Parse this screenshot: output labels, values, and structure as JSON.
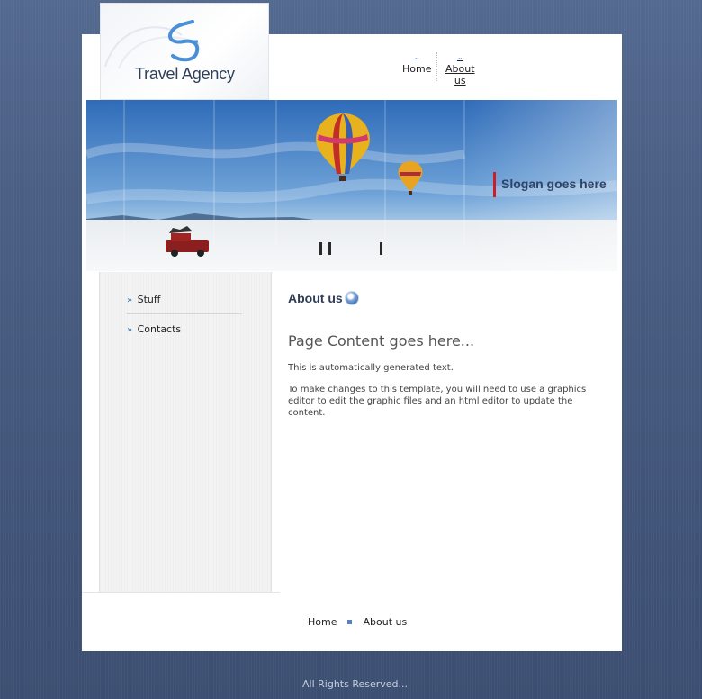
{
  "header": {
    "logo_text": "Travel Agency",
    "nav": [
      {
        "label": "Home"
      },
      {
        "label": "About us"
      }
    ]
  },
  "banner": {
    "slogan": "Slogan goes here"
  },
  "sidebar": {
    "items": [
      {
        "label": "Stuff"
      },
      {
        "label": "Contacts"
      }
    ]
  },
  "content": {
    "title": "About us",
    "heading": "Page Content goes here...",
    "p1": "This is automatically generated text.",
    "p2": "To make changes to this template, you will need to use a graphics editor to edit the graphic files and an html editor to update the content."
  },
  "footer": {
    "nav": [
      {
        "label": "Home"
      },
      {
        "label": "About us"
      }
    ],
    "copyright": "All Rights Reserved..."
  },
  "colors": {
    "accent": "#3a73b8",
    "slogan_bar": "#c8202a",
    "background": "#4a5f84"
  }
}
